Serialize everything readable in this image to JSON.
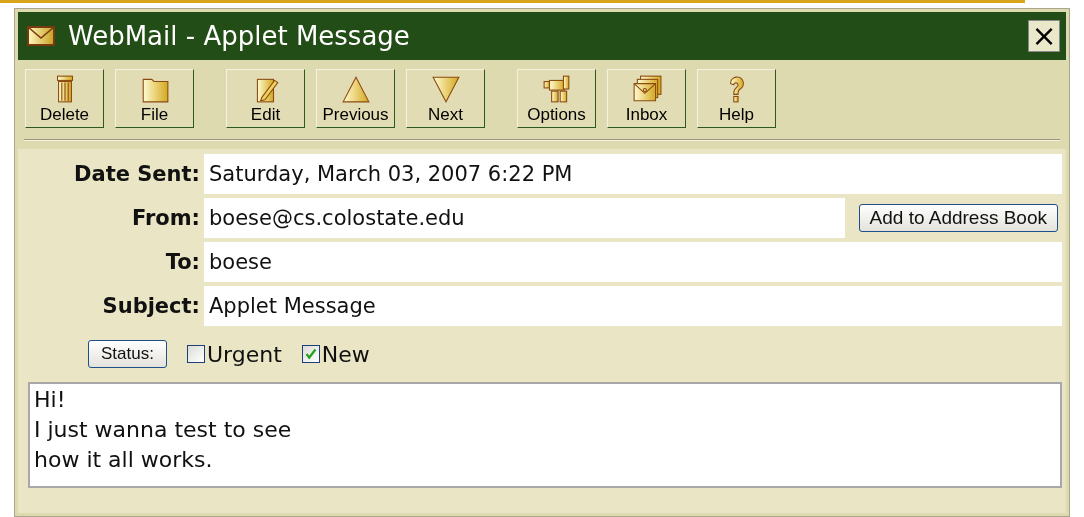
{
  "window": {
    "title": "WebMail - Applet Message",
    "close": "×"
  },
  "toolbar": [
    {
      "label": "Delete"
    },
    {
      "label": "File"
    },
    {
      "label": "Edit"
    },
    {
      "label": "Previous"
    },
    {
      "label": "Next"
    },
    {
      "label": "Options"
    },
    {
      "label": "Inbox"
    },
    {
      "label": "Help"
    }
  ],
  "header_fields": [
    {
      "label": "Date Sent:",
      "value": "Saturday, March 03, 2007 6:22 PM"
    },
    {
      "label": "From:",
      "value": "boese@cs.colostate.edu",
      "button": "Add to Address Book"
    },
    {
      "label": "To:",
      "value": "boese"
    },
    {
      "label": "Subject:",
      "value": "Applet Message"
    }
  ],
  "status": {
    "button": "Status:",
    "flags": [
      {
        "label": "Urgent",
        "checked": false
      },
      {
        "label": "New",
        "checked": true
      }
    ]
  },
  "message_body": "Hi!\nI just wanna test to see\nhow it all works."
}
